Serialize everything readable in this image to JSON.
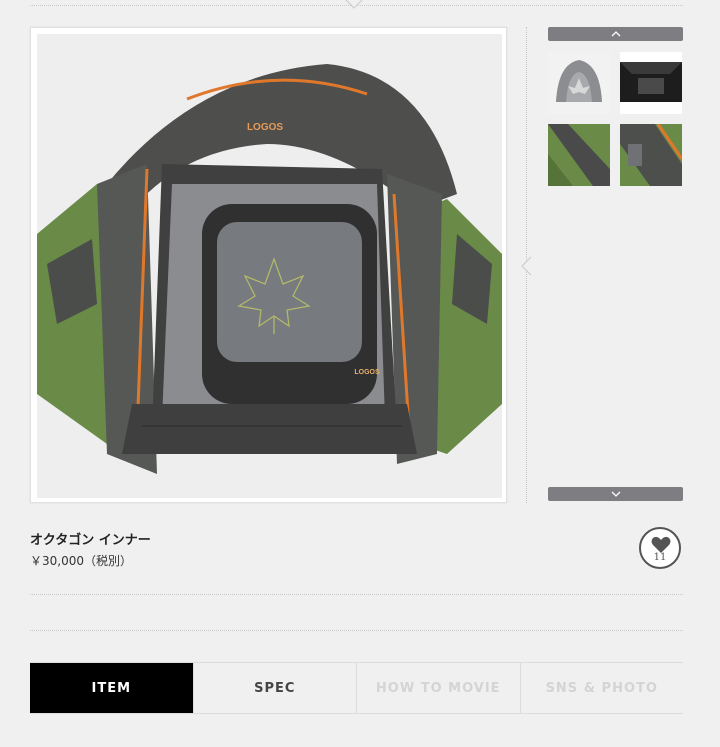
{
  "colors": {
    "accent": "#000000",
    "button_gray": "#7e7e82",
    "tent_green": "#6a8a48",
    "tent_dark": "#4a4a4a",
    "tent_orange": "#e0782c"
  },
  "gallery": {
    "main_image_icon": "tent-photo",
    "main_brand_text": "LOGOS",
    "thumbnails": [
      {
        "icon": "tent-back-photo"
      },
      {
        "icon": "tent-interior-photo"
      },
      {
        "icon": "tent-green-panel-photo"
      },
      {
        "icon": "tent-side-detail-photo"
      }
    ],
    "scroll_up_icon": "chevron-up-icon",
    "scroll_down_icon": "chevron-down-icon"
  },
  "product": {
    "name": "オクタゴン インナー",
    "price": "￥30,000（税別）"
  },
  "favorite": {
    "icon": "heart-icon",
    "count": "11"
  },
  "tabs": [
    {
      "label": "ITEM",
      "state": "active"
    },
    {
      "label": "SPEC",
      "state": "normal"
    },
    {
      "label": "HOW TO MOVIE",
      "state": "disabled"
    },
    {
      "label": "SNS & PHOTO",
      "state": "disabled"
    }
  ]
}
